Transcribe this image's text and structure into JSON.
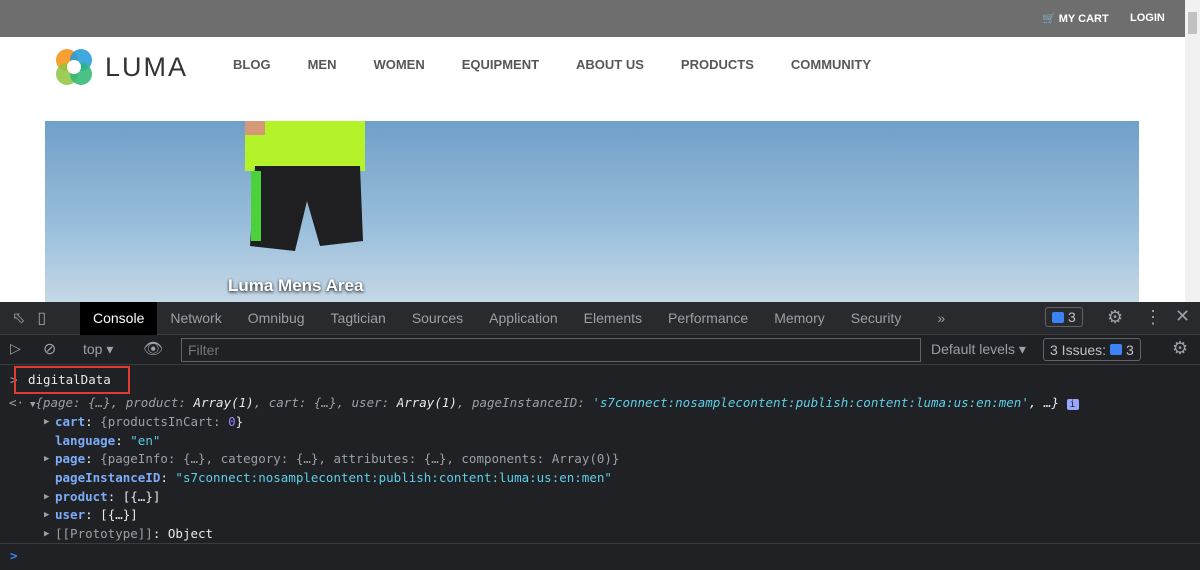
{
  "site": {
    "top_links": [
      "MY CART",
      "LOGIN"
    ],
    "logo_text": "LUMA",
    "nav": [
      "BLOG",
      "MEN",
      "WOMEN",
      "EQUIPMENT",
      "ABOUT US",
      "PRODUCTS",
      "COMMUNITY"
    ],
    "hero_caption": "Luma Mens Area"
  },
  "devtools": {
    "tabs": [
      "Console",
      "Network",
      "Omnibug",
      "Tagtician",
      "Sources",
      "Application",
      "Elements",
      "Performance",
      "Memory",
      "Security"
    ],
    "more": "»",
    "issues_badge": "3",
    "context": "top",
    "filter_placeholder": "Filter",
    "levels": "Default levels",
    "issues_label": "3 Issues:",
    "issues_count": "3",
    "input": "digitalData",
    "summary": {
      "p1": "{page: {…}, product: ",
      "a1": "Array(1)",
      "p2": ", cart: {…}, user: ",
      "a2": "Array(1)",
      "p3": ", pageInstanceID: ",
      "id": "'s7connect:nosamplecontent:publish:content:luma:us:en:men'",
      "p4": ", …}"
    },
    "rows": {
      "cart_key": "cart",
      "cart_val_pre": "{productsInCart: ",
      "cart_num": "0",
      "cart_val_post": "}",
      "lang_key": "language",
      "lang_val": "\"en\"",
      "page_key": "page",
      "page_val": "{pageInfo: {…}, category: {…}, attributes: {…}, components: Array(0)}",
      "pid_key": "pageInstanceID",
      "pid_val": "\"s7connect:nosamplecontent:publish:content:luma:us:en:men\"",
      "product_key": "product",
      "product_val": "[{…}]",
      "user_key": "user",
      "user_val": "[{…}]",
      "proto_key": "[[Prototype]]",
      "proto_val": "Object"
    }
  }
}
